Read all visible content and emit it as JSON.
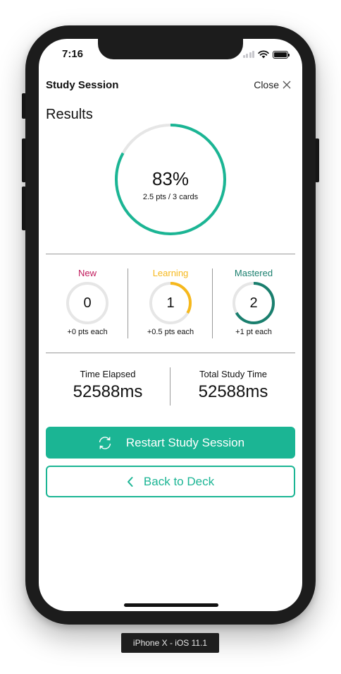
{
  "status_bar": {
    "time": "7:16",
    "signal_icon": "signal-icon",
    "wifi_icon": "wifi-icon",
    "battery_icon": "battery-icon"
  },
  "header": {
    "title": "Study Session",
    "close_label": "Close",
    "close_icon": "close-icon"
  },
  "results": {
    "title": "Results",
    "percent_text": "83%",
    "percent_value": 0.83,
    "subtitle": "2.5 pts / 3 cards",
    "ring_color": "#1bb594",
    "track_color": "#e6e6e6"
  },
  "stats": [
    {
      "label": "New",
      "count": "0",
      "each": "+0 pts each",
      "color": "#c0195b",
      "fraction": 0
    },
    {
      "label": "Learning",
      "count": "1",
      "each": "+0.5 pts each",
      "color": "#f6b81c",
      "fraction": 0.333
    },
    {
      "label": "Mastered",
      "count": "2",
      "each": "+1 pt each",
      "color": "#1a7f6e",
      "fraction": 0.667
    }
  ],
  "times": [
    {
      "label": "Time Elapsed",
      "value": "52588ms"
    },
    {
      "label": "Total Study Time",
      "value": "52588ms"
    }
  ],
  "actions": {
    "restart_label": "Restart Study Session",
    "restart_icon": "refresh-icon",
    "back_label": "Back to Deck",
    "back_icon": "chevron-left-icon"
  },
  "device_label": "iPhone X - iOS 11.1",
  "colors": {
    "accent": "#1bb594"
  }
}
